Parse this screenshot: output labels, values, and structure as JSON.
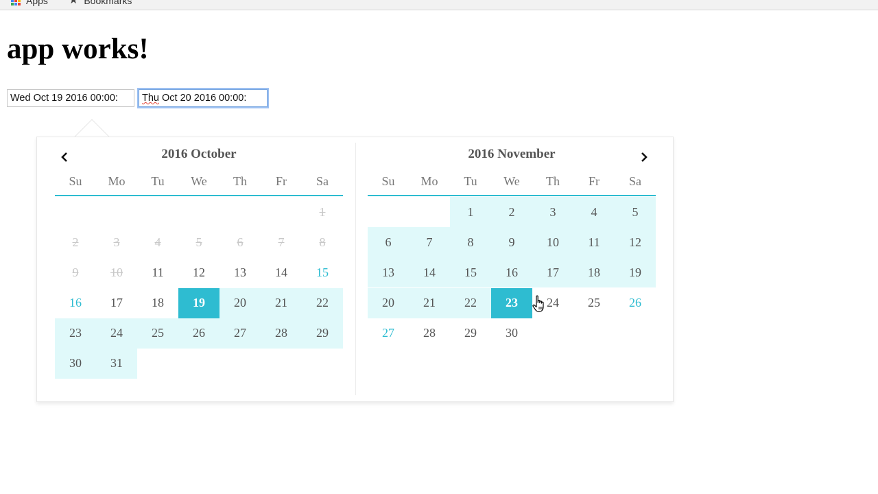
{
  "bookmarks_bar": {
    "items": [
      {
        "label": "Apps",
        "icon": "apps-grid-icon"
      },
      {
        "label": "Bookmarks",
        "icon": "star-icon"
      }
    ]
  },
  "page": {
    "title": "app works!"
  },
  "inputs": {
    "start": {
      "value": "Wed Oct 19 2016 00:00:"
    },
    "end": {
      "value_part1": "Thu",
      "value_part2": " Oct 20 2016 00:00:"
    }
  },
  "colors": {
    "accent": "#2ebcd1",
    "range": "#e0f9fa",
    "focus_ring": "#9cc0f2"
  },
  "calendar": {
    "weekdays": [
      "Su",
      "Mo",
      "Tu",
      "We",
      "Th",
      "Fr",
      "Sa"
    ],
    "prev_icon": "chevron-left-icon",
    "next_icon": "chevron-right-icon",
    "months": [
      {
        "title": "2016 October",
        "weeks": [
          [
            null,
            null,
            null,
            null,
            null,
            null,
            {
              "d": "1",
              "s": "disabled"
            }
          ],
          [
            {
              "d": "2",
              "s": "disabled"
            },
            {
              "d": "3",
              "s": "disabled"
            },
            {
              "d": "4",
              "s": "disabled"
            },
            {
              "d": "5",
              "s": "disabled"
            },
            {
              "d": "6",
              "s": "disabled"
            },
            {
              "d": "7",
              "s": "disabled"
            },
            {
              "d": "8",
              "s": "disabled"
            }
          ],
          [
            {
              "d": "9",
              "s": "disabled"
            },
            {
              "d": "10",
              "s": "disabled"
            },
            {
              "d": "11"
            },
            {
              "d": "12"
            },
            {
              "d": "13"
            },
            {
              "d": "14"
            },
            {
              "d": "15",
              "s": "weekend"
            }
          ],
          [
            {
              "d": "16",
              "s": "weekend"
            },
            {
              "d": "17"
            },
            {
              "d": "18"
            },
            {
              "d": "19",
              "s": "selected"
            },
            {
              "d": "20",
              "s": "in-range"
            },
            {
              "d": "21",
              "s": "in-range"
            },
            {
              "d": "22",
              "s": "in-range"
            }
          ],
          [
            {
              "d": "23",
              "s": "in-range"
            },
            {
              "d": "24",
              "s": "in-range"
            },
            {
              "d": "25",
              "s": "in-range"
            },
            {
              "d": "26",
              "s": "in-range"
            },
            {
              "d": "27",
              "s": "in-range"
            },
            {
              "d": "28",
              "s": "in-range"
            },
            {
              "d": "29",
              "s": "in-range"
            }
          ],
          [
            {
              "d": "30",
              "s": "in-range"
            },
            {
              "d": "31",
              "s": "in-range"
            },
            null,
            null,
            null,
            null,
            null
          ]
        ]
      },
      {
        "title": "2016 November",
        "weeks": [
          [
            null,
            null,
            {
              "d": "1",
              "s": "in-range"
            },
            {
              "d": "2",
              "s": "in-range"
            },
            {
              "d": "3",
              "s": "in-range"
            },
            {
              "d": "4",
              "s": "in-range"
            },
            {
              "d": "5",
              "s": "in-range"
            }
          ],
          [
            {
              "d": "6",
              "s": "in-range"
            },
            {
              "d": "7",
              "s": "in-range"
            },
            {
              "d": "8",
              "s": "in-range"
            },
            {
              "d": "9",
              "s": "in-range"
            },
            {
              "d": "10",
              "s": "in-range"
            },
            {
              "d": "11",
              "s": "in-range"
            },
            {
              "d": "12",
              "s": "in-range"
            }
          ],
          [
            {
              "d": "13",
              "s": "in-range"
            },
            {
              "d": "14",
              "s": "in-range"
            },
            {
              "d": "15",
              "s": "in-range"
            },
            {
              "d": "16",
              "s": "in-range"
            },
            {
              "d": "17",
              "s": "in-range"
            },
            {
              "d": "18",
              "s": "in-range"
            },
            {
              "d": "19",
              "s": "in-range"
            }
          ],
          [
            {
              "d": "20",
              "s": "in-range"
            },
            {
              "d": "21",
              "s": "in-range"
            },
            {
              "d": "22",
              "s": "in-range"
            },
            {
              "d": "23",
              "s": "selected"
            },
            {
              "d": "24"
            },
            {
              "d": "25"
            },
            {
              "d": "26",
              "s": "weekend"
            }
          ],
          [
            {
              "d": "27",
              "s": "weekend"
            },
            {
              "d": "28"
            },
            {
              "d": "29"
            },
            {
              "d": "30"
            },
            null,
            null,
            null
          ]
        ]
      }
    ]
  },
  "cursor": {
    "icon": "hand-pointer-icon"
  }
}
